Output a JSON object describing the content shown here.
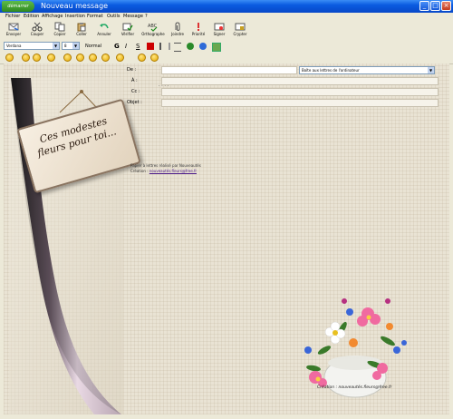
{
  "window": {
    "title": "Nouveau message",
    "start_label": "démarrer",
    "min_glyph": "_",
    "max_glyph": "□",
    "close_glyph": "×"
  },
  "menu": {
    "items": [
      "Fichier",
      "Edition",
      "Affichage",
      "Insertion",
      "Format",
      "Outils",
      "Message",
      "?"
    ]
  },
  "toolbar": {
    "buttons": [
      {
        "label": "Envoyer",
        "icon": "send-icon"
      },
      {
        "label": "Couper",
        "icon": "cut-icon"
      },
      {
        "label": "Copier",
        "icon": "copy-icon"
      },
      {
        "label": "Coller",
        "icon": "paste-icon"
      },
      {
        "label": "Annuler",
        "icon": "undo-icon"
      },
      {
        "label": "Vérifier",
        "icon": "check-names-icon"
      },
      {
        "label": "Orthographe",
        "icon": "spelling-icon"
      },
      {
        "label": "Joindre",
        "icon": "attach-icon"
      },
      {
        "label": "Priorité",
        "icon": "priority-icon"
      },
      {
        "label": "Signer",
        "icon": "sign-icon"
      },
      {
        "label": "Crypter",
        "icon": "encrypt-icon"
      }
    ]
  },
  "format": {
    "font": "Verdana",
    "size": "8",
    "style_label": "Normal"
  },
  "header": {
    "from_label": "De :",
    "from_value": "",
    "account_value": "Boîte aux lettres de l'ordinateur",
    "to_label": "À :",
    "cc_label": "Cc :",
    "subject_label": "Objet :"
  },
  "stationery": {
    "sign_text": "Ces modestes fleurs pour toi...",
    "message_line1": "Papier à lettres réalisé par Nouveautés",
    "message_line2": "Création :",
    "message_link": "nouveautés.fleurs@free.fr",
    "signature": "Création : nouveautés.fleurs@free.fr",
    "dots": ". . . ."
  }
}
